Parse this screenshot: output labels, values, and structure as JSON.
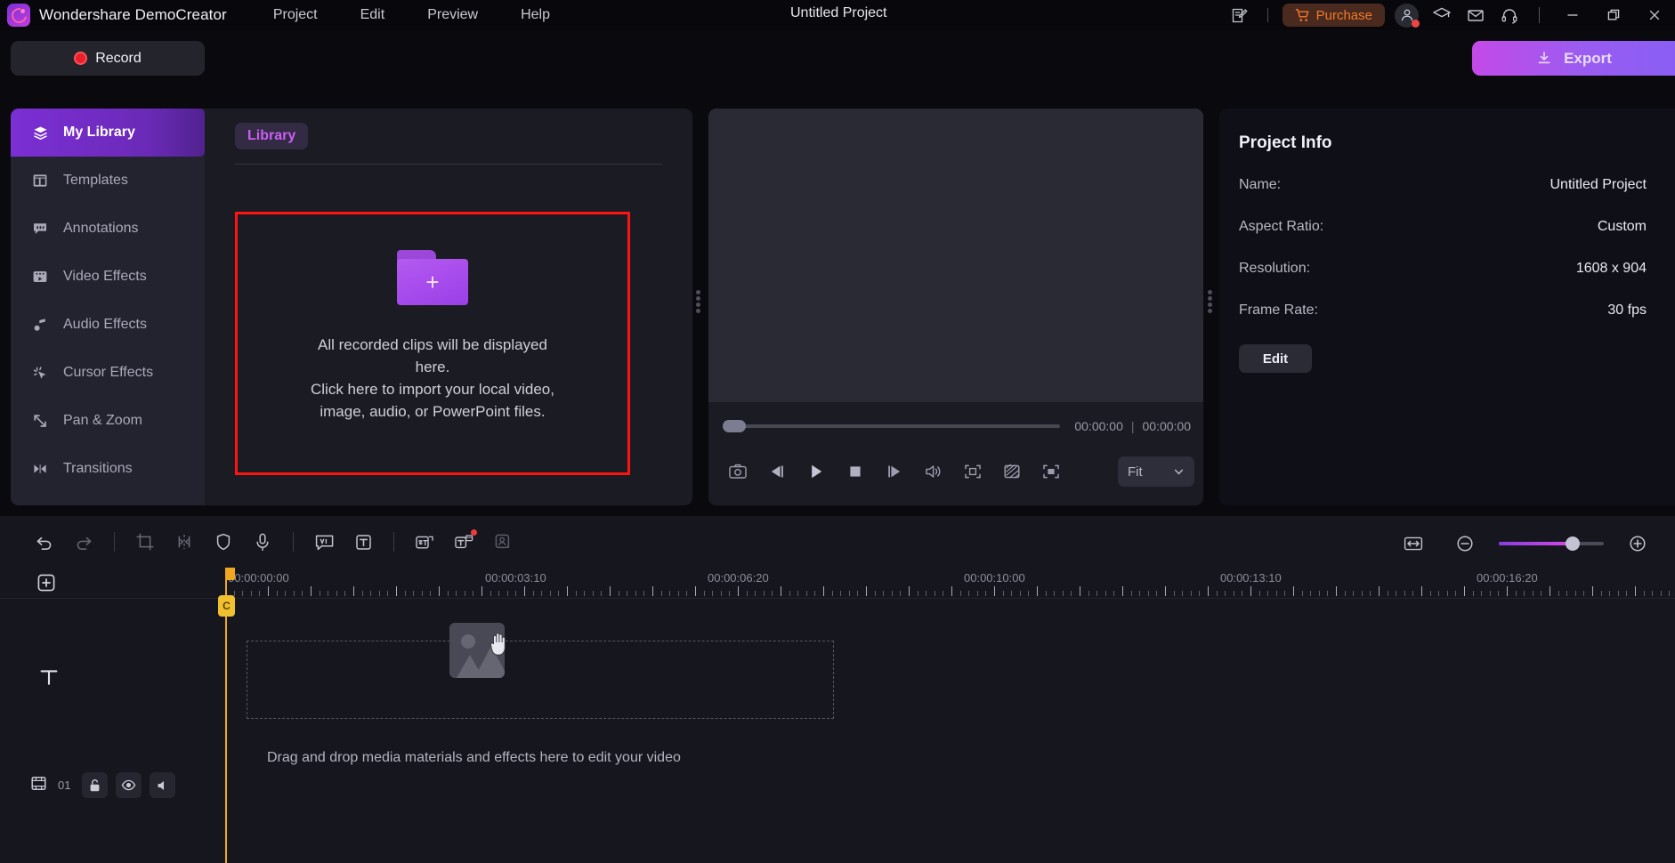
{
  "app": {
    "brand": "Wondershare DemoCreator",
    "project_title": "Untitled Project",
    "accent": "#9b3fe8",
    "highlight_border": "#ff1414",
    "playhead_color": "#f0a81e"
  },
  "menubar": {
    "items": [
      {
        "label": "Project",
        "name": "menu-project"
      },
      {
        "label": "Edit",
        "name": "menu-edit"
      },
      {
        "label": "Preview",
        "name": "menu-preview"
      },
      {
        "label": "Help",
        "name": "menu-help"
      }
    ],
    "purchase_label": "Purchase",
    "icons": [
      "new-project-icon",
      "cart-icon",
      "account-icon",
      "tutorials-icon",
      "mail-icon",
      "support-headset-icon",
      "minimize-icon",
      "restore-icon",
      "close-icon"
    ]
  },
  "toolbar": {
    "record_label": "Record",
    "export_label": "Export"
  },
  "sidebar": {
    "items": [
      {
        "label": "My Library",
        "icon": "layers-icon",
        "active": true
      },
      {
        "label": "Templates",
        "icon": "templates-icon",
        "active": false
      },
      {
        "label": "Annotations",
        "icon": "annotation-icon",
        "active": false
      },
      {
        "label": "Video Effects",
        "icon": "video-effects-icon",
        "active": false
      },
      {
        "label": "Audio Effects",
        "icon": "audio-effects-icon",
        "active": false
      },
      {
        "label": "Cursor Effects",
        "icon": "cursor-effects-icon",
        "active": false
      },
      {
        "label": "Pan & Zoom",
        "icon": "pan-zoom-icon",
        "active": false
      },
      {
        "label": "Transitions",
        "icon": "transitions-icon",
        "active": false
      }
    ]
  },
  "library": {
    "tab_label": "Library",
    "dropzone": {
      "line1": "All recorded clips will be displayed",
      "line2": "here.",
      "line3": "Click here to import your local video,",
      "line4": "image, audio, or PowerPoint files."
    }
  },
  "preview": {
    "current_time": "00:00:00",
    "total_time": "00:00:00",
    "separator": "|",
    "fit_label": "Fit",
    "controls": [
      "snapshot-icon",
      "prev-frame-icon",
      "play-icon",
      "stop-icon",
      "next-frame-icon",
      "volume-icon",
      "crop-marker-icon",
      "no-signal-icon",
      "fullscreen-icon"
    ]
  },
  "project_info": {
    "title": "Project Info",
    "rows": [
      {
        "key": "Name:",
        "value": "Untitled Project"
      },
      {
        "key": "Aspect Ratio:",
        "value": "Custom"
      },
      {
        "key": "Resolution:",
        "value": "1608 x 904"
      },
      {
        "key": "Frame Rate:",
        "value": "30 fps"
      }
    ],
    "edit_label": "Edit"
  },
  "timeline": {
    "tools": [
      "undo-icon",
      "redo-icon",
      "crop-icon",
      "split-icon",
      "color-shield-icon",
      "voice-record-icon",
      "caption-icon",
      "text-icon",
      "speech-to-text-icon",
      "text-to-speech-icon",
      "silence-detection-icon"
    ],
    "zoom": {
      "fit_icon": "fit-timeline-icon",
      "zoom_out_icon": "zoom-out-icon",
      "zoom_in_icon": "zoom-in-icon",
      "level_percent": 70
    },
    "add_track_label": "+",
    "ruler_marks": [
      "00:00:00:00",
      "00:00:03:10",
      "00:00:06:20",
      "00:00:10:00",
      "00:00:13:10",
      "00:00:16:20"
    ],
    "track": {
      "text_track_icon": "text-track-icon",
      "video_track_icon": "video-track-icon",
      "number": "01",
      "lock_icon": "unlock-icon",
      "visibility_icon": "eye-icon",
      "mute_icon": "speaker-icon"
    },
    "drop_hint": "Drag and drop media materials and effects here to edit your video",
    "playhead_badge": "C"
  }
}
